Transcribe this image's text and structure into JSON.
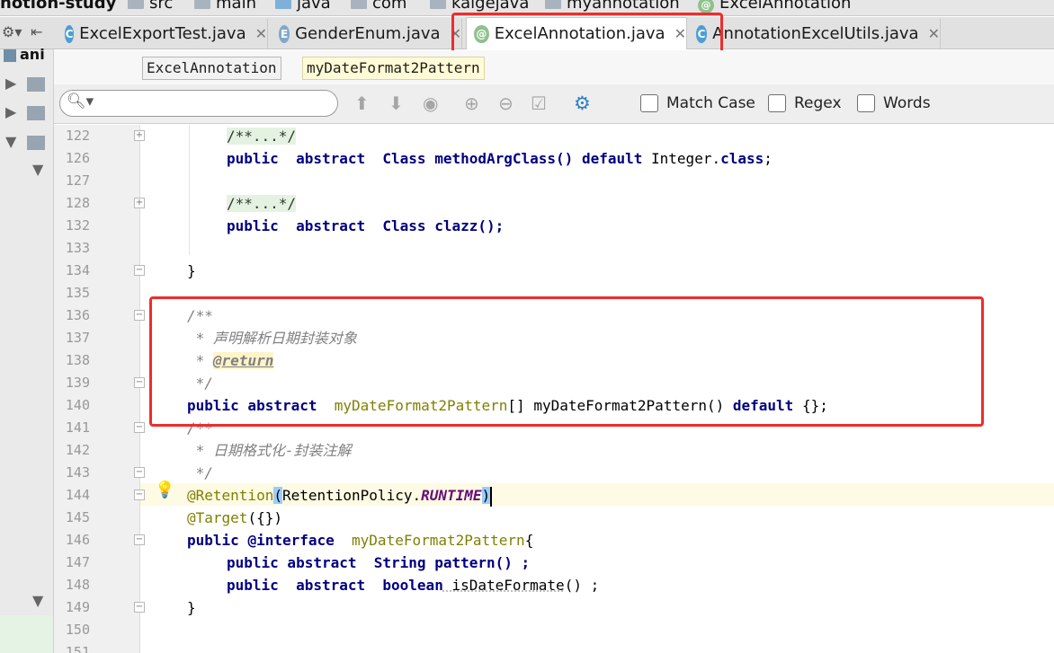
{
  "nav": {
    "crumbs": [
      "notion-study",
      "src",
      "main",
      "java",
      "com",
      "kaigejava",
      "myannotation",
      "ExcelAnnotation"
    ]
  },
  "tabs": [
    {
      "label": "ExcelExportTest.java",
      "icon": "C"
    },
    {
      "label": "GenderEnum.java",
      "icon": "E"
    },
    {
      "label": "ExcelAnnotation.java",
      "icon": "@"
    },
    {
      "label": "AnnotationExcelUtils.java",
      "icon": "C"
    }
  ],
  "project": {
    "root_label": "ani"
  },
  "code_breadcrumb": [
    "ExcelAnnotation",
    "myDateFormat2Pattern"
  ],
  "search": {
    "placeholder": "",
    "match_case": "Match Case",
    "regex": "Regex",
    "words": "Words"
  },
  "editor": {
    "line_numbers": [
      "122",
      "126",
      "127",
      "128",
      "132",
      "133",
      "134",
      "135",
      "136",
      "137",
      "138",
      "139",
      "140",
      "141",
      "142",
      "143",
      "144",
      "145",
      "146",
      "147",
      "148",
      "149",
      "150",
      "151"
    ],
    "lines": {
      "l122_fold": "/**...*/",
      "l126_a": "public  abstract  Class methodArgClass() ",
      "l126_default": "default",
      "l126_b": " Integer.",
      "l126_class": "class",
      "l126_c": ";",
      "l128_fold": "/**...*/",
      "l132_a": "public  abstract  Class clazz();",
      "l134": "}",
      "l136": "/**",
      "l137": " * 声明解析日期封装对象",
      "l138_star": " * ",
      "l138_tag": "@return",
      "l139": " */",
      "l140_pub": "public abstract  ",
      "l140_type": "myDateFormat2Pattern",
      "l140_mid": "[] myDateFormat2Pattern() ",
      "l140_default": "default",
      "l140_end": " {};",
      "l141": "/**",
      "l142": " * 日期格式化-封装注解",
      "l143": " */",
      "l144_ann": "@Retention",
      "l144_open": "(",
      "l144_policy": "RetentionPolicy.",
      "l144_runtime": "RUNTIME",
      "l144_close": ")",
      "l145_ann": "@Target",
      "l145_rest": "({})",
      "l146_pub": "public ",
      "l146_iface": "@interface",
      "l146_space": "  ",
      "l146_name": "myDateFormat2Pattern",
      "l146_brace": "{",
      "l147": "public abstract  String pattern() ;",
      "l148_a": "public  abstract  ",
      "l148_bool": "boolean",
      "l148_method": " isDateFormate",
      "l148_end": "() ;",
      "l149": "}"
    }
  },
  "colors": {
    "keyword": "#000080",
    "comment": "#808080",
    "annotation": "#808000",
    "constant": "#660e7a",
    "highlight_box": "#ef2c2c",
    "caret_line": "#fffae3"
  }
}
